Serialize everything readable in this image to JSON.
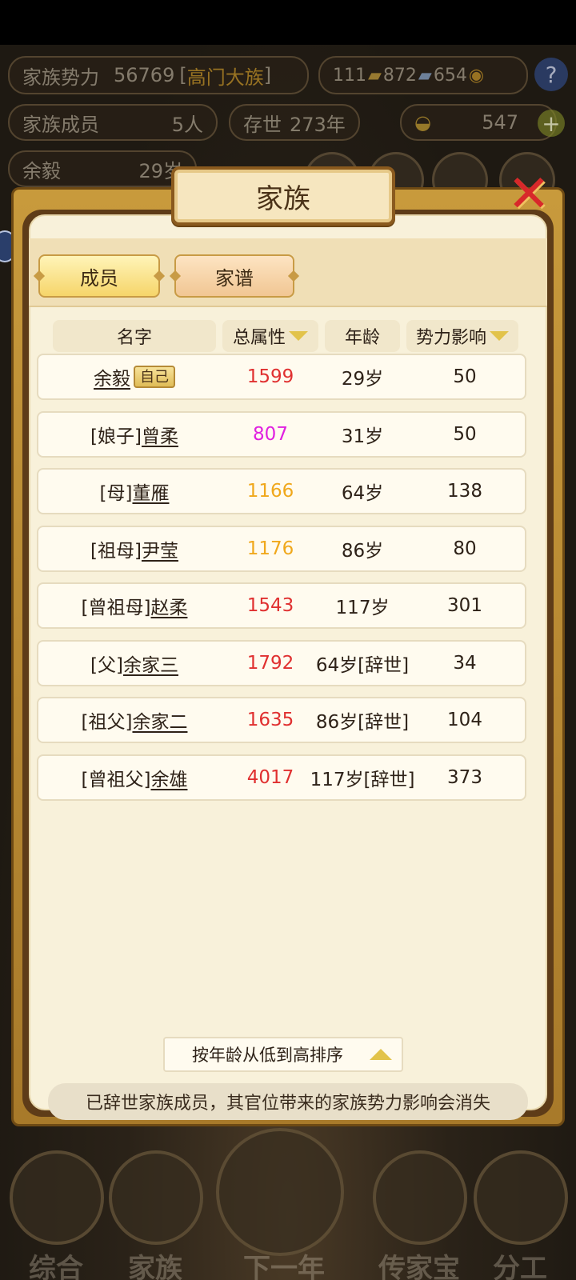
{
  "background": {
    "clan_power_label": "家族势力",
    "clan_power_value": "56769",
    "clan_rank": "高门大族",
    "res_gold_bars": "111",
    "res_silver_bars": "872",
    "res_coins": "654",
    "members_label": "家族成员",
    "members_value": "5人",
    "existence_label": "存世",
    "existence_value": "273年",
    "ingots": "547",
    "person_name": "余毅",
    "person_age": "29岁"
  },
  "nav": [
    {
      "label": "综合"
    },
    {
      "label": "家族"
    },
    {
      "label": "下一年"
    },
    {
      "label": "传家宝"
    },
    {
      "label": "分工"
    }
  ],
  "modal": {
    "title": "家族",
    "tabs": {
      "members": "成员",
      "tree": "家谱"
    },
    "headers": {
      "name": "名字",
      "attr": "总属性",
      "age": "年龄",
      "influence": "势力影响"
    },
    "self_badge": "自己",
    "rows": [
      {
        "prefix": "",
        "name": "余毅",
        "attr": "1599",
        "age": "29岁",
        "influence": "50",
        "attr_color": "#e03030"
      },
      {
        "prefix": "[娘子]",
        "name": "曾柔",
        "attr": "807",
        "age": "31岁",
        "influence": "50",
        "attr_color": "#e020e0"
      },
      {
        "prefix": "[母]",
        "name": "董雁",
        "attr": "1166",
        "age": "64岁",
        "influence": "138",
        "attr_color": "#f0a81c"
      },
      {
        "prefix": "[祖母]",
        "name": "尹莹",
        "attr": "1176",
        "age": "86岁",
        "influence": "80",
        "attr_color": "#f0a81c"
      },
      {
        "prefix": "[曾祖母]",
        "name": "赵柔",
        "attr": "1543",
        "age": "117岁",
        "influence": "301",
        "attr_color": "#e03030"
      },
      {
        "prefix": "[父]",
        "name": "余家三",
        "attr": "1792",
        "age": "64岁[辞世]",
        "influence": "34",
        "attr_color": "#e03030"
      },
      {
        "prefix": "[祖父]",
        "name": "余家二",
        "attr": "1635",
        "age": "86岁[辞世]",
        "influence": "104",
        "attr_color": "#e03030"
      },
      {
        "prefix": "[曾祖父]",
        "name": "余雄",
        "attr": "4017",
        "age": "117岁[辞世]",
        "influence": "373",
        "attr_color": "#e03030"
      }
    ],
    "sort_label": "按年龄从低到高排序",
    "notice": "已辞世家族成员，其官位带来的家族势力影响会消失"
  }
}
